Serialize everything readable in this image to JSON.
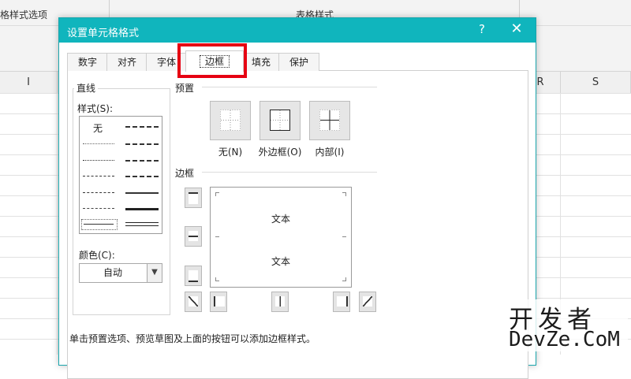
{
  "ribbon": {
    "group_table_style_options": "格样式选项",
    "group_table_styles": "表格样式"
  },
  "sheet": {
    "column_headers": [
      "I",
      "R",
      "S"
    ]
  },
  "dialog": {
    "title": "设置单元格格式",
    "help_glyph": "?",
    "close_glyph": "✕",
    "tabs": [
      {
        "label": "数字"
      },
      {
        "label": "对齐"
      },
      {
        "label": "字体"
      },
      {
        "label": "边框",
        "active": true
      },
      {
        "label": "填充"
      },
      {
        "label": "保护"
      }
    ],
    "line": {
      "group_title": "直线",
      "style_label": "样式(S):",
      "style_none": "无",
      "color_label": "颜色(C):",
      "color_value": "自动"
    },
    "presets": {
      "section_title": "预置",
      "buttons": [
        {
          "label": "无(N)",
          "icon": "no-border-icon"
        },
        {
          "label": "外边框(O)",
          "icon": "outline-border-icon"
        },
        {
          "label": "内部(I)",
          "icon": "inside-border-icon"
        }
      ]
    },
    "border": {
      "section_title": "边框",
      "preview_text_top": "文本",
      "preview_text_bottom": "文本"
    },
    "hint": "单击预置选项、预览草图及上面的按钮可以添加边框样式。"
  },
  "watermark": {
    "cn": "开发者",
    "en": "DevZe.CoM"
  },
  "colors": {
    "title_bar": "#10b5bd",
    "highlight": "#e60012"
  }
}
